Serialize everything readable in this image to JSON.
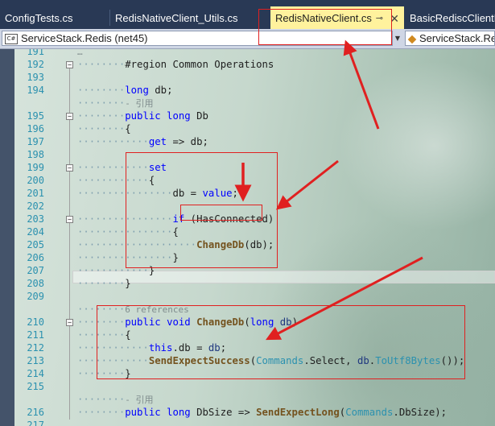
{
  "tabs": [
    {
      "label": "ConfigTests.cs",
      "active": false
    },
    {
      "label": "RedisNativeClient_Utils.cs",
      "active": false
    },
    {
      "label": "RedisNativeClient.cs",
      "active": true
    },
    {
      "label": "BasicRediscClientM",
      "active": false
    }
  ],
  "tab_pin_glyph": "⊸",
  "tab_close_glyph": "✕",
  "navbar": {
    "project": "ServiceStack.Redis (net45)",
    "type": "ServiceStack.Re"
  },
  "icon_labels": {
    "csharp_project": "C#"
  },
  "colors": {
    "tab_bar": "#293955",
    "active_tab": "#fff29d",
    "annotation": "#e02020"
  },
  "lines": [
    {
      "n": "191",
      "dots": "",
      "t": [
        [
          "…",
          "lens"
        ]
      ]
    },
    {
      "n": "192",
      "dots": "········",
      "t": [
        [
          "#region Common Operations",
          "region"
        ]
      ]
    },
    {
      "n": "193",
      "dots": "",
      "t": []
    },
    {
      "n": "194",
      "dots": "········",
      "t": [
        [
          "long",
          "kw"
        ],
        [
          " db;",
          ""
        ]
      ]
    },
    {
      "n": "",
      "dots": "········",
      "t": [
        [
          "- 引用",
          "lens"
        ]
      ]
    },
    {
      "n": "195",
      "dots": "········",
      "t": [
        [
          "public",
          "kw"
        ],
        [
          " ",
          ""
        ],
        [
          "long",
          "kw"
        ],
        [
          " Db",
          ""
        ]
      ]
    },
    {
      "n": "196",
      "dots": "········",
      "t": [
        [
          "{",
          ""
        ]
      ]
    },
    {
      "n": "197",
      "dots": "············",
      "t": [
        [
          "get",
          "kw"
        ],
        [
          " => db;",
          ""
        ]
      ]
    },
    {
      "n": "198",
      "dots": "",
      "t": []
    },
    {
      "n": "199",
      "dots": "············",
      "t": [
        [
          "set",
          "kw"
        ]
      ]
    },
    {
      "n": "200",
      "dots": "············",
      "t": [
        [
          "{",
          ""
        ]
      ]
    },
    {
      "n": "201",
      "dots": "················",
      "t": [
        [
          "db = ",
          ""
        ],
        [
          "value",
          "kw"
        ],
        [
          ";",
          ""
        ]
      ]
    },
    {
      "n": "202",
      "dots": "",
      "t": []
    },
    {
      "n": "203",
      "dots": "················",
      "t": [
        [
          "if",
          "kw"
        ],
        [
          " (HasConnected)",
          ""
        ]
      ]
    },
    {
      "n": "204",
      "dots": "················",
      "t": [
        [
          "{",
          ""
        ]
      ]
    },
    {
      "n": "205",
      "dots": "····················",
      "t": [
        [
          "ChangeDb",
          "mth"
        ],
        [
          "(db);",
          ""
        ]
      ]
    },
    {
      "n": "206",
      "dots": "················",
      "t": [
        [
          "}",
          ""
        ]
      ]
    },
    {
      "n": "207",
      "dots": "············",
      "t": [
        [
          "}",
          ""
        ]
      ]
    },
    {
      "n": "208",
      "dots": "········",
      "t": [
        [
          "}",
          ""
        ]
      ]
    },
    {
      "n": "209",
      "dots": "",
      "t": []
    },
    {
      "n": "",
      "dots": "········",
      "t": [
        [
          "6 references",
          "lens"
        ]
      ]
    },
    {
      "n": "210",
      "dots": "········",
      "t": [
        [
          "public",
          "kw"
        ],
        [
          " ",
          ""
        ],
        [
          "void",
          "kw"
        ],
        [
          " ",
          ""
        ],
        [
          "ChangeDb",
          "mth"
        ],
        [
          "(",
          ""
        ],
        [
          "long",
          "kw"
        ],
        [
          " ",
          ""
        ],
        [
          "db",
          "var"
        ],
        [
          ")",
          ""
        ]
      ]
    },
    {
      "n": "211",
      "dots": "········",
      "t": [
        [
          "{",
          ""
        ]
      ]
    },
    {
      "n": "212",
      "dots": "············",
      "t": [
        [
          "this",
          "kw"
        ],
        [
          ".db = ",
          ""
        ],
        [
          "db",
          "var"
        ],
        [
          ";",
          ""
        ]
      ]
    },
    {
      "n": "213",
      "dots": "············",
      "t": [
        [
          "SendExpectSuccess",
          "mth"
        ],
        [
          "(",
          ""
        ],
        [
          "Commands",
          "cls"
        ],
        [
          ".Select, ",
          ""
        ],
        [
          "db",
          "var"
        ],
        [
          ".",
          ""
        ],
        [
          "ToUtf8Bytes",
          "cls"
        ],
        [
          "());",
          ""
        ]
      ]
    },
    {
      "n": "214",
      "dots": "········",
      "t": [
        [
          "}",
          ""
        ]
      ]
    },
    {
      "n": "215",
      "dots": "",
      "t": []
    },
    {
      "n": "",
      "dots": "········",
      "t": [
        [
          "- 引用",
          "lens"
        ]
      ]
    },
    {
      "n": "216",
      "dots": "········",
      "t": [
        [
          "public",
          "kw"
        ],
        [
          " ",
          ""
        ],
        [
          "long",
          "kw"
        ],
        [
          " DbSize => ",
          ""
        ],
        [
          "SendExpectLong",
          "mth"
        ],
        [
          "(",
          ""
        ],
        [
          "Commands",
          "cls"
        ],
        [
          ".DbSize);",
          ""
        ]
      ]
    },
    {
      "n": "217",
      "dots": "",
      "t": []
    }
  ]
}
